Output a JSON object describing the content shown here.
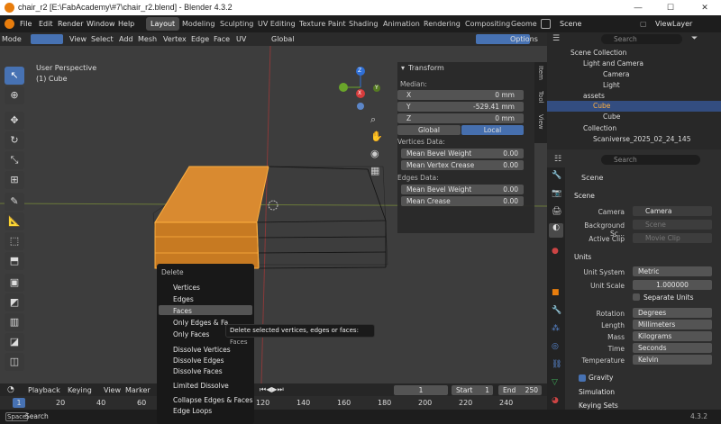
{
  "window": {
    "title": "chair_r2 [E:\\FabAcademy\\#7\\chair_r2.blend] - Blender 4.3.2",
    "minimize": "—",
    "maximize": "☐",
    "close": "✕"
  },
  "menubar": {
    "items": [
      "File",
      "Edit",
      "Render",
      "Window",
      "Help"
    ],
    "workspaces": [
      "Layout",
      "Modeling",
      "Sculpting",
      "UV Editing",
      "Texture Paint",
      "Shading",
      "Animation",
      "Rendering",
      "Compositing",
      "Geome"
    ],
    "active_workspace": "Layout",
    "scene": "Scene",
    "view_layer": "ViewLayer"
  },
  "viewport_header": {
    "mode": "Mode",
    "menus": [
      "View",
      "Select",
      "Add",
      "Mesh",
      "Vertex",
      "Edge",
      "Face",
      "UV"
    ],
    "orientation": "Global",
    "options": "Options"
  },
  "viewport": {
    "view_name": "User Perspective",
    "object_name": "(1) Cube",
    "gizmo_axes": {
      "z": "Z",
      "y": "Y",
      "x": "X"
    }
  },
  "npanel": {
    "title": "Transform",
    "median_label": "Median:",
    "x_label": "X",
    "x_value": "0 mm",
    "y_label": "Y",
    "y_value": "-529.41 mm",
    "z_label": "Z",
    "z_value": "0 mm",
    "global_btn": "Global",
    "local_btn": "Local",
    "vertices_data": "Vertices Data:",
    "mean_bevel_weight_label": "Mean Bevel Weight",
    "mean_bevel_weight_v": "0.00",
    "mean_vertex_crease_label": "Mean Vertex Crease",
    "mean_vertex_crease_v": "0.00",
    "edges_data": "Edges Data:",
    "edge_bevel_weight_label": "Mean Bevel Weight",
    "edge_bevel_weight_v": "0.00",
    "mean_crease_label": "Mean Crease",
    "mean_crease_v": "0.00",
    "tabs": [
      "Item",
      "Tool",
      "View"
    ]
  },
  "context_menu": {
    "title": "Delete",
    "items": [
      "Vertices",
      "Edges",
      "Faces",
      "Only Edges & Fa",
      "Only Faces",
      "Dissolve Vertices",
      "Dissolve Edges",
      "Dissolve Faces",
      "Limited Dissolve",
      "Collapse Edges & Faces",
      "Edge Loops"
    ],
    "highlighted": "Faces"
  },
  "tooltip": {
    "text": "Delete selected vertices, edges or faces:",
    "value": "Faces"
  },
  "timeline": {
    "menus": [
      "Playback",
      "Keying",
      "View",
      "Marker"
    ],
    "current_frame": "1",
    "start_label": "Start",
    "start_value": "1",
    "end_label": "End",
    "end_value": "250",
    "ruler": [
      "1",
      "20",
      "40",
      "60",
      "120",
      "140",
      "160",
      "180",
      "200",
      "220",
      "240"
    ]
  },
  "status": {
    "space": "Space",
    "search": "Search",
    "version": "4.3.2"
  },
  "outliner": {
    "search_placeholder": "Search",
    "items": [
      {
        "label": "Scene Collection"
      },
      {
        "label": "Light and Camera"
      },
      {
        "label": "Camera"
      },
      {
        "label": "Light"
      },
      {
        "label": "assets"
      },
      {
        "label": "Cube"
      },
      {
        "label": "Cube"
      },
      {
        "label": "Collection"
      },
      {
        "label": "Scaniverse_2025_02_24_145"
      }
    ]
  },
  "properties": {
    "search_placeholder": "Search",
    "breadcrumb": "Scene",
    "scene_section": "Scene",
    "camera_label": "Camera",
    "camera_value": "Camera",
    "bg_scene_label": "Background Sc...",
    "bg_scene_value": "Scene",
    "active_clip_label": "Active Clip",
    "active_clip_value": "Movie Clip",
    "units_section": "Units",
    "unit_system_label": "Unit System",
    "unit_system_value": "Metric",
    "unit_scale_label": "Unit Scale",
    "unit_scale_value": "1.000000",
    "separate_units": "Separate Units",
    "rotation_label": "Rotation",
    "rotation_value": "Degrees",
    "length_label": "Length",
    "length_value": "Millimeters",
    "mass_label": "Mass",
    "mass_value": "Kilograms",
    "time_label": "Time",
    "time_value": "Seconds",
    "temperature_label": "Temperature",
    "temperature_value": "Kelvin",
    "gravity": "Gravity",
    "simulation": "Simulation",
    "keying_sets": "Keying Sets"
  },
  "colors": {
    "accent": "#4772b3",
    "selection": "#f0a040",
    "bg": "#303030"
  }
}
